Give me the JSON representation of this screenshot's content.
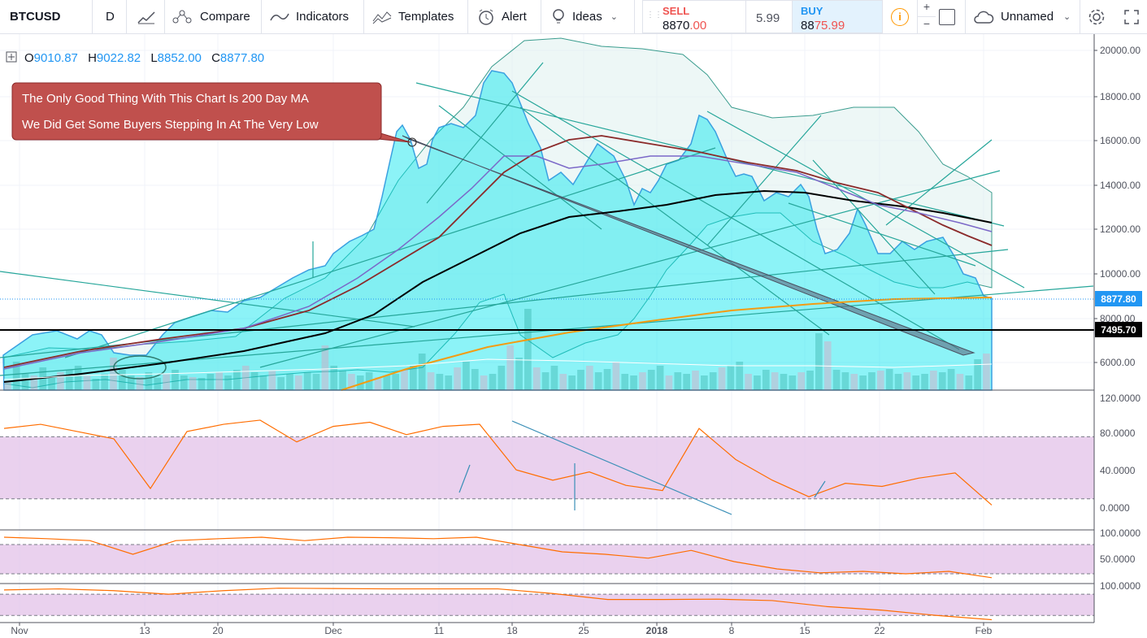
{
  "toolbar": {
    "symbol": "BTCUSD",
    "interval": "D",
    "compare": "Compare",
    "indicators": "Indicators",
    "templates": "Templates",
    "alert": "Alert",
    "ideas": "Ideas",
    "sell_label": "SELL",
    "sell_price_a": "8870",
    "sell_price_b": ".00",
    "spread": "5.99",
    "buy_label": "BUY",
    "buy_price_a": "88",
    "buy_price_b": "75.99",
    "layout_name": "Unnamed",
    "plus": "+",
    "minus": "−",
    "info": "i"
  },
  "colors": {
    "sell": "#ef5350",
    "buy": "#2196f3",
    "sell_bg": "#fde8e8",
    "buy_bg": "#e3f2fd",
    "area_fill": "#5bc0de",
    "ma200": "#f39c12",
    "ma_black": "#000000",
    "ma_red": "#8b2a2a",
    "ma_purple": "#7b68c8",
    "rsi": "#ff6d00",
    "band": "#e1bee7",
    "annotation_bg": "#c0504d"
  },
  "legend": {
    "open_label": "O",
    "open": "9010.87",
    "high_label": "H",
    "high": "9022.82",
    "low_label": "L",
    "low": "8852.00",
    "close_label": "C",
    "close": "8877.80"
  },
  "annotation": {
    "line1": "The Only Good Thing With This Chart Is 200 Day MA",
    "line2": "We Did Get Some Buyers Stepping In At The Very Low"
  },
  "price_badges": {
    "last": "8877.80",
    "support": "7495.70"
  },
  "chart_data": [
    {
      "type": "area",
      "x": [
        "Nov 1",
        "Nov 13",
        "Nov 20",
        "Dec 1",
        "Dec 11",
        "Dec 18",
        "Dec 24",
        "Dec 31",
        "Jan 8",
        "Jan 15",
        "Jan 22",
        "Feb 1"
      ],
      "series": [
        {
          "values": [
            6400,
            6500,
            8200,
            9800,
            16400,
            19000,
            13800,
            13700,
            15000,
            13500,
            11000,
            8880
          ]
        }
      ],
      "ylim": [
        4800,
        20400
      ],
      "y_ticks": [
        "20000.00",
        "18000.00",
        "16000.00",
        "14000.00",
        "12000.00",
        "10000.00",
        "8000.00",
        "6000.00"
      ],
      "x_ticks": [
        "Nov",
        "13",
        "20",
        "Dec",
        "11",
        "18",
        "25",
        "2018",
        "8",
        "15",
        "22",
        "Feb"
      ],
      "horizontal_lines": [
        8877.8,
        7495.7
      ]
    },
    {
      "type": "line",
      "ylim": [
        -10,
        125
      ],
      "y_ticks": [
        "120.0000",
        "80.0000",
        "40.0000",
        "0.0000"
      ],
      "band": [
        20,
        80
      ],
      "series": [
        {
          "values": [
            88,
            92,
            85,
            78,
            30,
            85,
            92,
            96,
            75,
            90,
            94,
            82,
            90,
            92,
            48,
            38,
            46,
            33,
            28,
            88,
            58,
            38,
            22,
            35,
            32,
            40,
            45,
            14
          ]
        }
      ]
    },
    {
      "type": "line",
      "ylim": [
        0,
        110
      ],
      "y_ticks": [
        "100.0000",
        "50.0000"
      ],
      "band": [
        20,
        80
      ],
      "series": [
        {
          "values": [
            95,
            92,
            88,
            60,
            88,
            92,
            95,
            88,
            95,
            94,
            92,
            95,
            80,
            65,
            60,
            52,
            68,
            45,
            30,
            22,
            25,
            20,
            25,
            12
          ]
        }
      ]
    },
    {
      "type": "line",
      "ylim": [
        0,
        110
      ],
      "y_ticks": [
        "100.0000"
      ],
      "band": [
        20,
        80
      ],
      "series": [
        {
          "values": [
            92,
            95,
            90,
            80,
            90,
            97,
            96,
            95,
            95,
            95,
            82,
            65,
            65,
            66,
            62,
            45,
            35,
            20,
            8
          ]
        }
      ]
    }
  ]
}
